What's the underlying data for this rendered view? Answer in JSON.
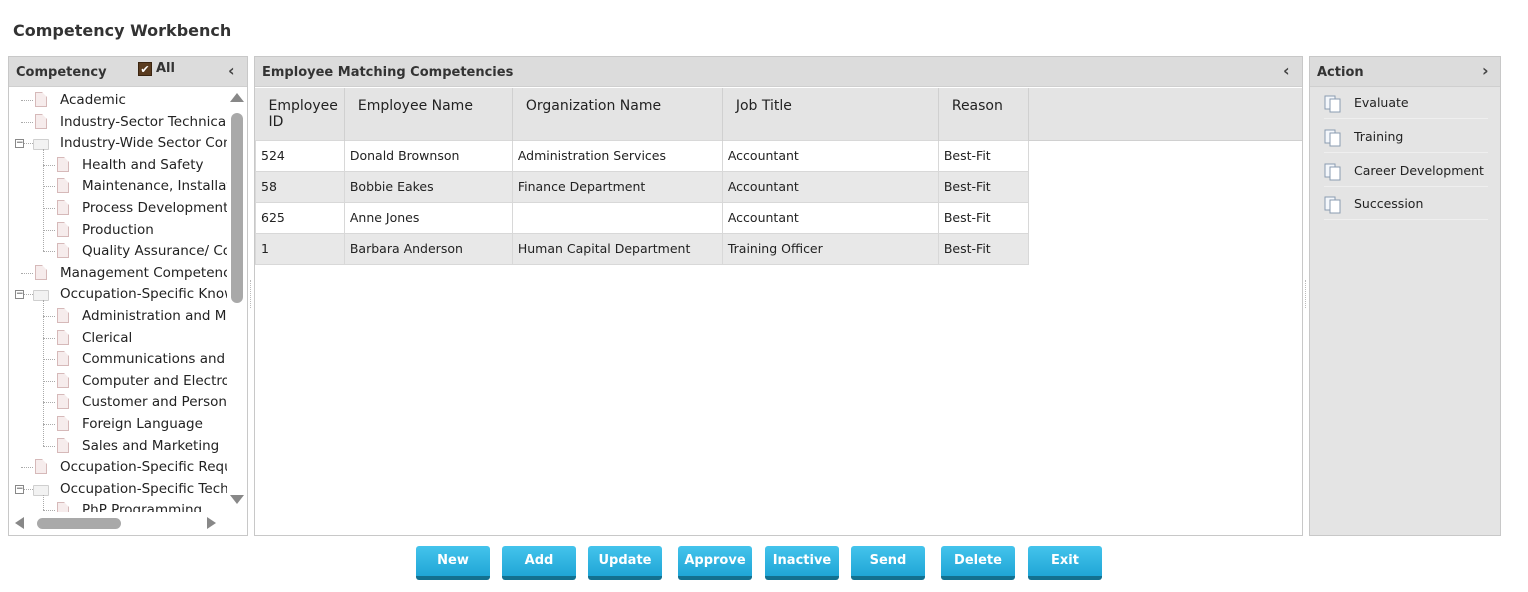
{
  "page": {
    "title": "Competency Workbench"
  },
  "competency": {
    "title": "Competency",
    "all_label": "All",
    "all_checked": true,
    "tree": [
      {
        "label": "Academic",
        "level": 0,
        "kind": "doc"
      },
      {
        "label": "Industry-Sector Technical",
        "level": 0,
        "kind": "doc"
      },
      {
        "label": "Industry-Wide Sector Com",
        "level": 0,
        "kind": "folder",
        "expanded": true
      },
      {
        "label": "Health and Safety",
        "level": 1,
        "kind": "doc"
      },
      {
        "label": "Maintenance, Installati",
        "level": 1,
        "kind": "doc"
      },
      {
        "label": "Process Development",
        "level": 1,
        "kind": "doc"
      },
      {
        "label": "Production",
        "level": 1,
        "kind": "doc"
      },
      {
        "label": "Quality Assurance/ Co",
        "level": 1,
        "kind": "doc"
      },
      {
        "label": "Management Competenci",
        "level": 0,
        "kind": "doc"
      },
      {
        "label": "Occupation-Specific Know",
        "level": 0,
        "kind": "folder",
        "expanded": true
      },
      {
        "label": "Administration and Ma",
        "level": 1,
        "kind": "doc"
      },
      {
        "label": "Clerical",
        "level": 1,
        "kind": "doc"
      },
      {
        "label": "Communications and I",
        "level": 1,
        "kind": "doc"
      },
      {
        "label": "Computer and Electror",
        "level": 1,
        "kind": "doc"
      },
      {
        "label": "Customer and Persona",
        "level": 1,
        "kind": "doc"
      },
      {
        "label": "Foreign Language",
        "level": 1,
        "kind": "doc"
      },
      {
        "label": "Sales and Marketing",
        "level": 1,
        "kind": "doc"
      },
      {
        "label": "Occupation-Specific Requi",
        "level": 0,
        "kind": "doc"
      },
      {
        "label": "Occupation-Specific Techr",
        "level": 0,
        "kind": "folder",
        "expanded": true
      },
      {
        "label": "PhP Programming",
        "level": 1,
        "kind": "doc"
      }
    ]
  },
  "employees": {
    "title": "Employee Matching Competencies",
    "columns": [
      "Employee ID",
      "Employee Name",
      "Organization Name",
      "Job Title",
      "Reason"
    ],
    "rows": [
      [
        "524",
        "Donald Brownson",
        "Administration Services",
        "Accountant",
        "Best-Fit"
      ],
      [
        "58",
        "Bobbie Eakes",
        "Finance Department",
        "Accountant",
        "Best-Fit"
      ],
      [
        "625",
        "Anne Jones",
        "",
        "Accountant",
        "Best-Fit"
      ],
      [
        "1",
        "Barbara Anderson",
        "Human Capital Department",
        "Training Officer",
        "Best-Fit"
      ]
    ]
  },
  "action": {
    "title": "Action",
    "items": [
      "Evaluate",
      "Training",
      "Career Development",
      "Succession"
    ]
  },
  "buttons": [
    "New",
    "Add",
    "Update",
    "Approve",
    "Inactive",
    "Send",
    "Delete",
    "Exit"
  ],
  "colors": {
    "button": "#20a6d6",
    "header": "#dcdcdc"
  }
}
